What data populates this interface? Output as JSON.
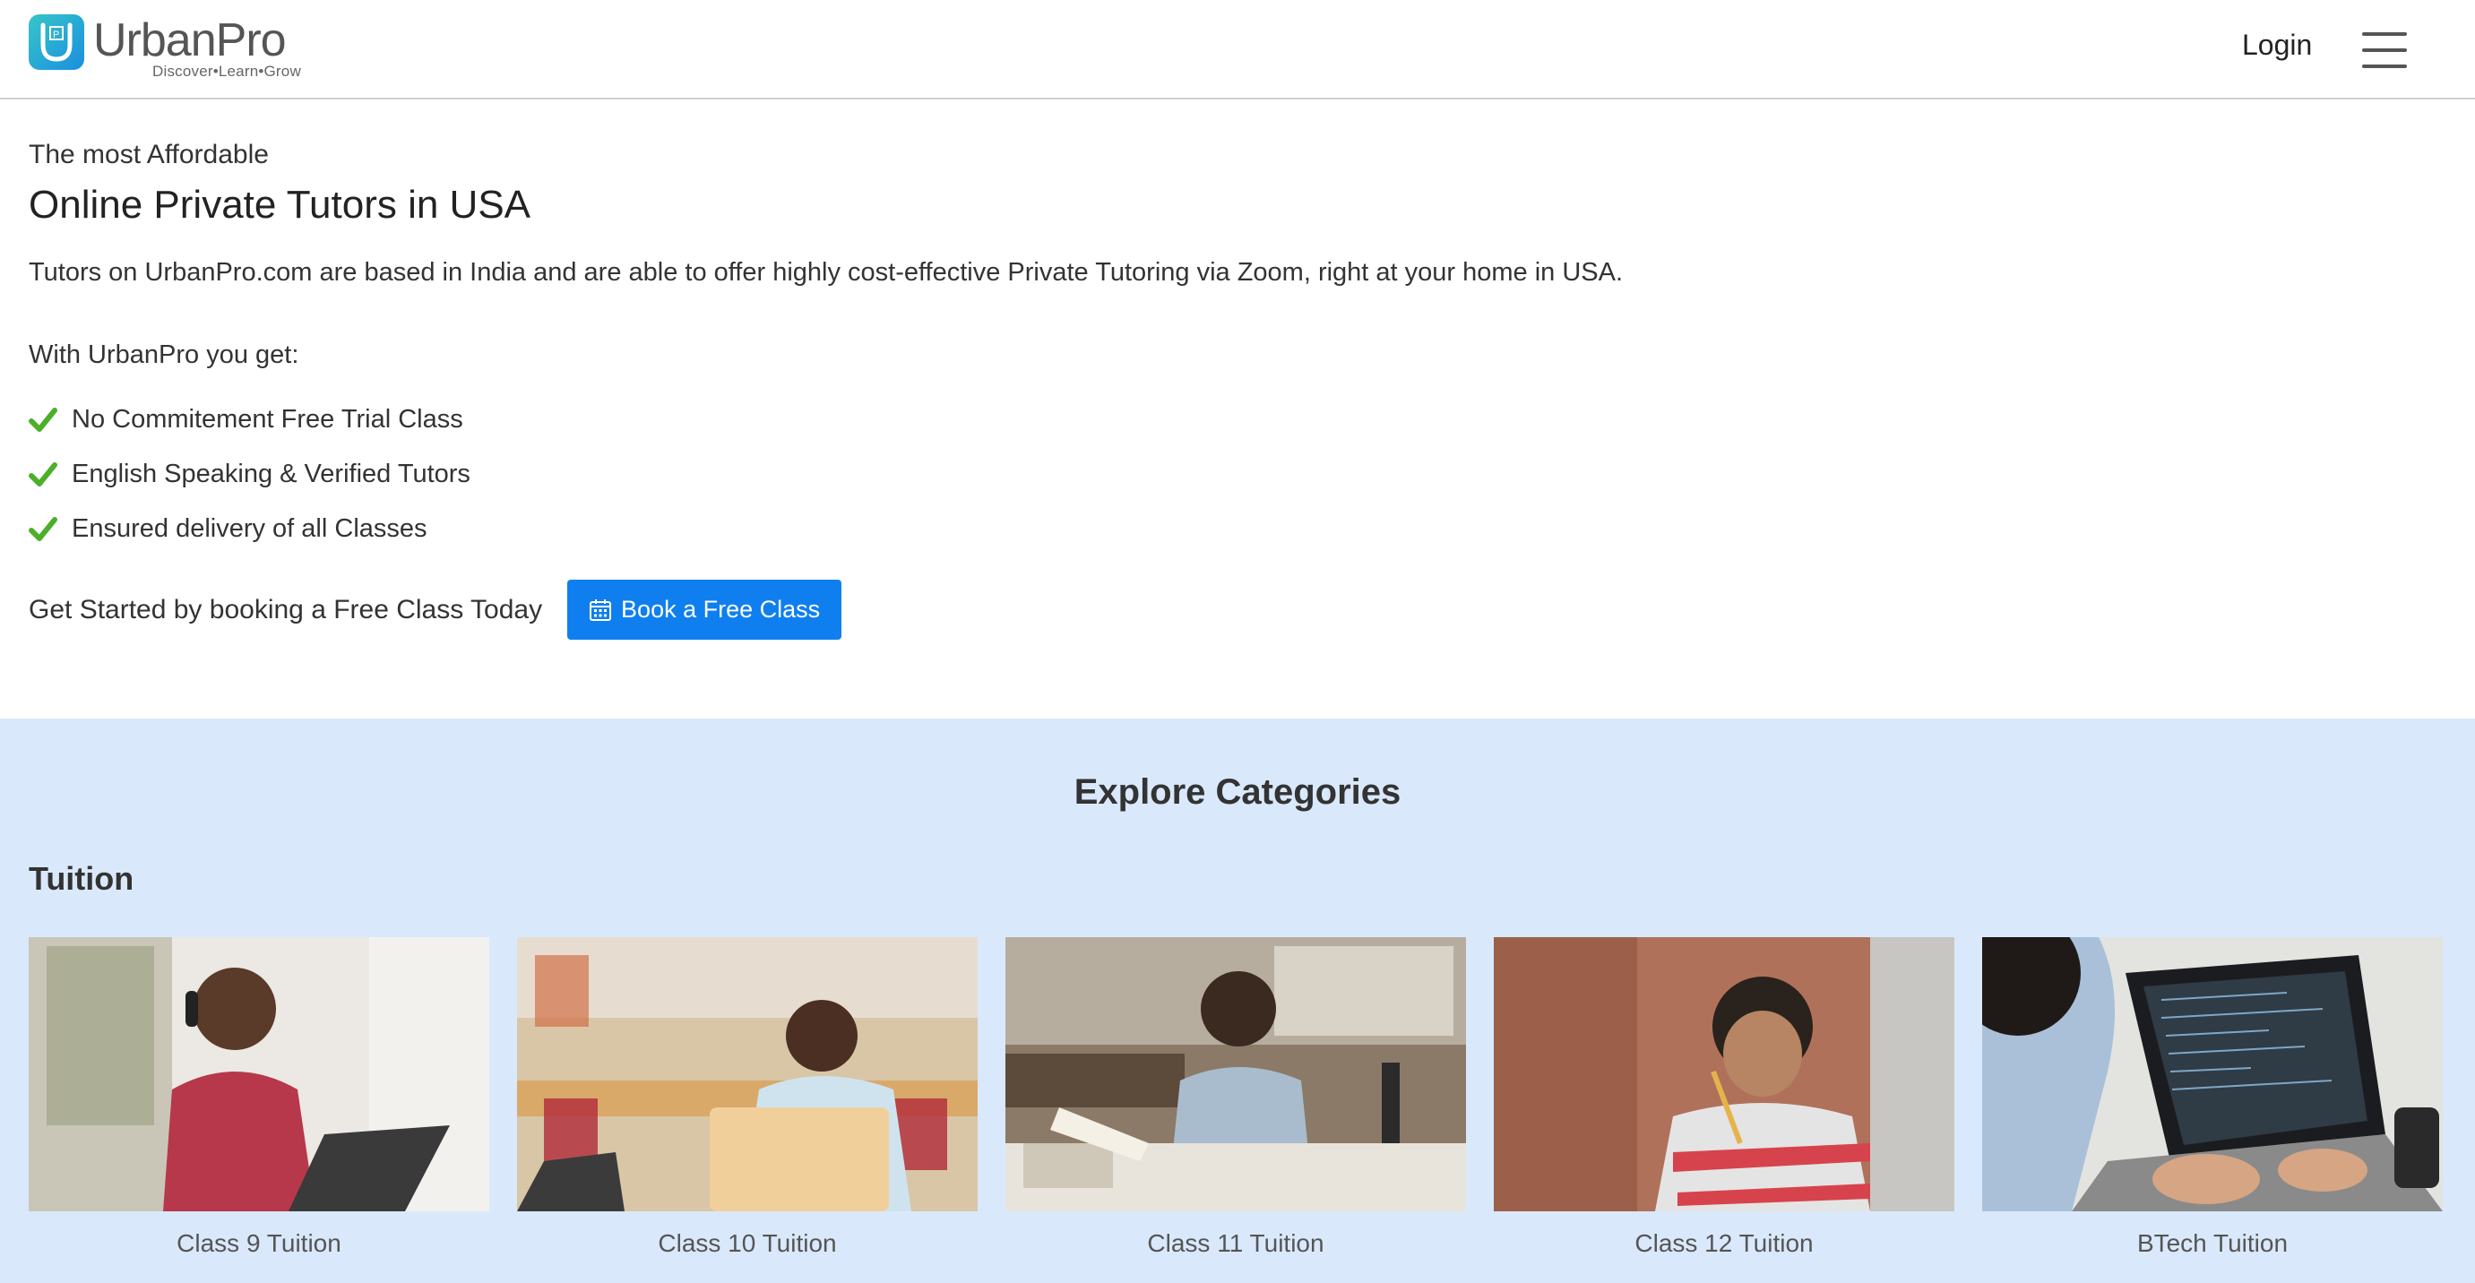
{
  "header": {
    "brand_name": "UrbanPro",
    "tagline": "Discover•Learn•Grow",
    "login_label": "Login",
    "icons": {
      "logo": "urbanpro-logo-icon",
      "menu": "hamburger-menu-icon"
    }
  },
  "hero": {
    "eyebrow": "The most Affordable",
    "title": "Online Private Tutors in USA",
    "description": "Tutors on UrbanPro.com are based in India and are able to offer highly cost-effective Private Tutoring via Zoom, right at your home in USA.",
    "benefits_heading": "With UrbanPro you get:",
    "benefits": [
      "No Commitement Free Trial Class",
      "English Speaking & Verified Tutors",
      "Ensured delivery of all Classes"
    ],
    "cta_text": "Get Started by booking a Free Class Today",
    "cta_button": "Book a Free Class",
    "accent_color": "#0f7ff0",
    "check_color": "#4caf2a"
  },
  "categories": {
    "title": "Explore Categories",
    "section": "Tuition",
    "background": "#d9e9fb",
    "items": [
      {
        "label": "Class 9 Tuition"
      },
      {
        "label": "Class 10 Tuition"
      },
      {
        "label": "Class 11 Tuition"
      },
      {
        "label": "Class 12 Tuition"
      },
      {
        "label": "BTech Tuition"
      }
    ]
  }
}
